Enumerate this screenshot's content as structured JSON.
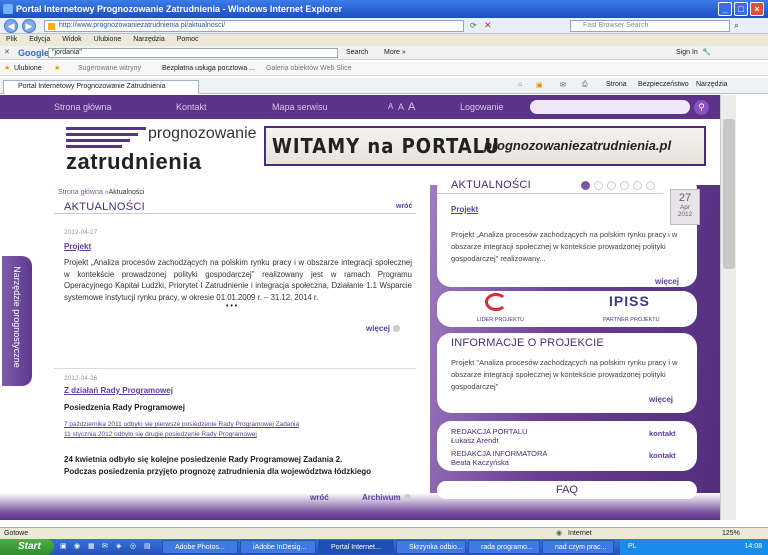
{
  "window": {
    "title": "Portal Internetowy Prognozowanie Zatrudnienia - Windows Internet Explorer"
  },
  "address": {
    "url": "http://www.prognozowaniezatrudnienia.pl/aktualnosci/",
    "search_placeholder": "Fast Browser Search"
  },
  "menu": [
    "Plik",
    "Edycja",
    "Widok",
    "Ulubione",
    "Narzędzia",
    "Pomoc"
  ],
  "google": {
    "logo": "Google",
    "query": "\"jordania\"",
    "search_label": "Search",
    "more_label": "More »",
    "signin_label": "Sign In"
  },
  "favorites": {
    "label": "Ulubione",
    "items": [
      "Sugerowane witryny",
      "Bezpłatna usługa pocztowa ...",
      "Galeria obiektów Web Slice"
    ]
  },
  "tab": {
    "title": "Portal Internetowy Prognozowanie Zatrudnienia"
  },
  "commandbar": {
    "page": "Strona",
    "security": "Bezpieczeństwo",
    "tools": "Narzędzia"
  },
  "site_nav": {
    "items": [
      "Strona główna",
      "Kontakt",
      "Mapa serwisu"
    ],
    "font_sizes": [
      "A",
      "A",
      "A"
    ],
    "login": "Logowanie"
  },
  "logo": {
    "line1": "prognozowanie",
    "line2": "zatrudnienia"
  },
  "banner": {
    "text1": "WITAMY na PORTALU",
    "text2": "prognozowaniezatrudnienia.pl"
  },
  "breadcrumb": {
    "home": "Strona główna",
    "sep": "»",
    "current": "Aktualności"
  },
  "main": {
    "title": "AKTUALNOŚCI",
    "back": "wróć",
    "articles": [
      {
        "date": "2012-04-27",
        "title": "Projekt",
        "body": "Projekt „Analiza procesów zachodzących na polskim rynku pracy i w obszarze integracji społecznej w kontekście prowadzonej polityki gospodarczej\" realizowany jest w ramach Programu Operacyjnego Kapitał Ludzki, Priorytet I Zatrudnienie i integracja społeczna, Działanie 1.1 Wsparcie systemowe instytucji rynku pracy, w okresie 01.01.2009 r. – 31.12. 2014 r.",
        "ellipsis": "• • •",
        "more": "więcej"
      },
      {
        "date": "2012-04-26",
        "title": "Z działań Rady Programowej",
        "subtitle": "Posiedzenia Rady Programowej",
        "links": [
          "7 października 2011 odbyło się pierwsze posiedzenie Rady Programowej Zadania",
          "11 stycznia 2012 odbyło się drugie posiedzenie Rady Programowej"
        ],
        "bold1": "24 kwietnia odbyło się kolejne posiedzenie Rady Programowej Zadania 2.",
        "bold2": "Podczas posiedzenia przyjęto prognozę zatrudnienia dla województwa łódzkiego"
      }
    ],
    "footer_back": "wróć",
    "archive": "Archiwum"
  },
  "side_tab": "Narzędzie prognostyczne",
  "news_panel": {
    "title": "AKTUALNOŚCI",
    "date_day": "27",
    "date_month": "Apr",
    "date_year": "2012",
    "link": "Projekt",
    "text": "Projekt „Analiza procesów zachodzących na polskim rynku pracy i w obszarze integracji społecznej w kontekście prowadzonej polityki gospodarczej\" realizowany...",
    "more": "więcej"
  },
  "partners": {
    "leader_caption": "LIDER PROJEKTU",
    "partner_logo": "IPISS",
    "partner_caption": "PARTNER PROJEKTU"
  },
  "project_panel": {
    "title": "INFORMACJE O PROJEKCIE",
    "text": "Projekt \"Analiza procesów zachodzących na polskim rynku pracy i w obszarze integracji społecznej w kontekście prowadzonej polityki gospodarczej\"",
    "more": "więcej"
  },
  "contact_panel": {
    "rows": [
      {
        "label": "REDAKCJA PORTALU",
        "name": "Łukasz Arendt",
        "link": "kontakt"
      },
      {
        "label": "REDAKCJA INFORMATORA",
        "name": "Beata Kaczyńska",
        "link": "kontakt"
      }
    ]
  },
  "faq": "FAQ",
  "statusbar": {
    "left": "Gotowe",
    "zone": "Internet",
    "zoom": "125%"
  },
  "taskbar": {
    "start": "Start",
    "tasks": [
      "Adobe Photos...",
      "iAdobe InDesig...",
      "Portal Internet...",
      "Skrzynka odbio...",
      "rada programo...",
      "nad czym prac..."
    ],
    "lang": "PL",
    "clock": "14:08"
  }
}
